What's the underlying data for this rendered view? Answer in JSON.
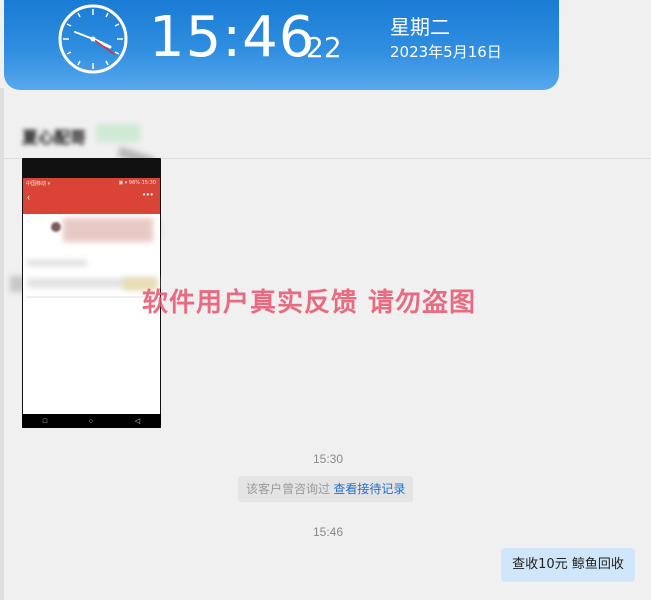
{
  "clock": {
    "time": "15:46",
    "seconds": "22",
    "weekday": "星期二",
    "date": "2023年5月16日"
  },
  "chat": {
    "contact_name": "夏心配哥",
    "contact_tag": "微信",
    "watermark": "软件用户真实反馈  请勿盗图",
    "timestamps": [
      "15:30",
      "15:46"
    ],
    "system_notice": {
      "text": "该客户曾咨询过",
      "link": "查看接待记录"
    },
    "outgoing_message": "查收10元 鲸鱼回收"
  },
  "phone_screenshot": {
    "status_text": "中国移动 ▾",
    "status_right": "▣ ▾ 96% 15:30",
    "nav_icons": [
      "square-icon",
      "circle-icon",
      "back-triangle-icon"
    ]
  },
  "colors": {
    "clock_banner": "#2f8ee0",
    "phone_header": "#d94436",
    "watermark": "#e8546e",
    "link": "#1f6fd1",
    "outgoing_bubble": "#cfe6fb"
  }
}
